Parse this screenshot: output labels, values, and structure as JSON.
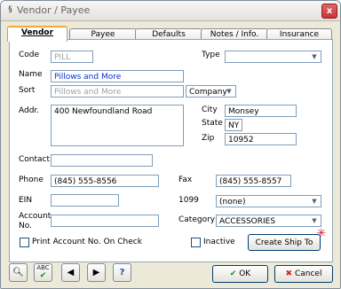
{
  "window": {
    "title": "Vendor / Payee",
    "close_label": "x"
  },
  "tabs": [
    "Vendor",
    "Payee",
    "Defaults",
    "Notes / Info.",
    "Insurance"
  ],
  "labels": {
    "code": "Code",
    "type": "Type",
    "name": "Name",
    "sort": "Sort",
    "addr": "Addr.",
    "city": "City",
    "state": "State",
    "zip": "Zip",
    "contact": "Contact",
    "phone": "Phone",
    "fax": "Fax",
    "ein": "EIN",
    "form1099": "1099",
    "account_line1": "Account",
    "account_line2": "No.",
    "category": "Category"
  },
  "values": {
    "code": "PILL",
    "type": "",
    "name": "Pillows and More",
    "sort": "Pillows and More",
    "sort_type": "Company",
    "address": "400 Newfoundland Road",
    "city": "Monsey",
    "state": "NY",
    "zip": "10952",
    "contact": "",
    "phone": "(845) 555-8556",
    "fax": "(845) 555-8557",
    "ein": "",
    "form1099": "(none)",
    "account": "",
    "category": "ACCESSORIES"
  },
  "checkboxes": {
    "print_account": "Print Account No. On Check",
    "inactive": "Inactive"
  },
  "buttons": {
    "create_ship_to": "Create Ship To",
    "ok": "OK",
    "cancel": "Cancel"
  },
  "icons": {
    "find": "search-icon",
    "spell": "spell-check-icon",
    "prev": "prev-arrow-icon",
    "next": "next-arrow-icon",
    "help": "help-icon",
    "ok": "check-icon",
    "cancel": "cancel-icon"
  },
  "colors": {
    "name_value": "#0b2fd3",
    "ok_check": "#1a8f1a",
    "cancel_x": "#c62828",
    "active_tab_accent": "#f4a93a"
  }
}
